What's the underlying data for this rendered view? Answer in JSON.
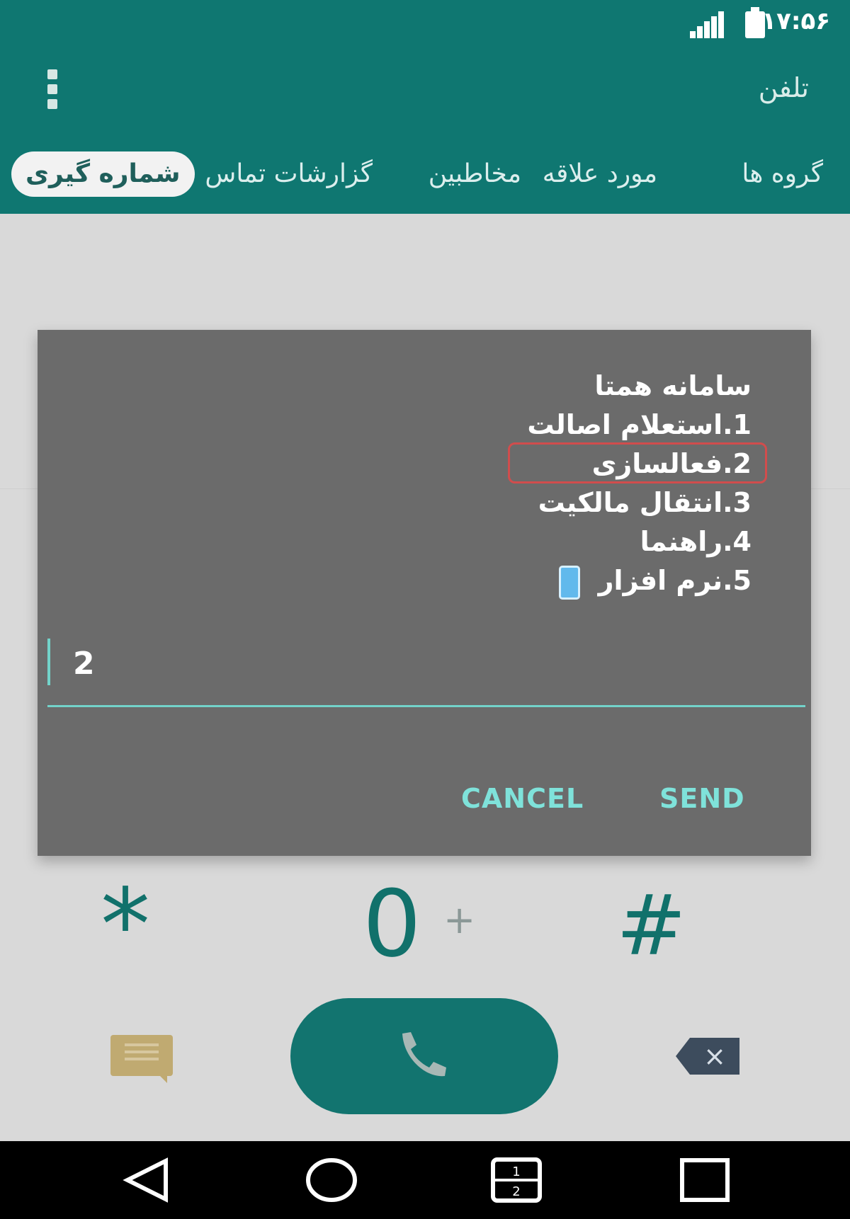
{
  "status_bar": {
    "time": "۱۷:۵۶"
  },
  "app_bar": {
    "title": "تلفن"
  },
  "tabs": [
    {
      "label": "گروه ها"
    },
    {
      "label": "مورد علاقه"
    },
    {
      "label": "مخاطبین"
    },
    {
      "label": "گزارشات تماس"
    },
    {
      "label": "شماره گیری"
    }
  ],
  "ussd_dialog": {
    "title": "سامانه همتا",
    "options": [
      "1.استعلام اصالت",
      "2.فعالسازی",
      "3.انتقال مالکیت",
      "4.راهنما",
      "5.نرم افزار"
    ],
    "input_value": "2",
    "cancel_label": "CANCEL",
    "send_label": "SEND"
  },
  "dialpad": {
    "star_label": "*",
    "zero_label": "0",
    "plus_label": "+",
    "hash_label": "#"
  },
  "icons": {
    "message": "message-icon",
    "call": "phone-icon",
    "backspace": "backspace-icon",
    "back": "back-icon",
    "home": "home-icon",
    "recent": "recent-apps-icon",
    "dual_sim": "dual-sim-icon"
  },
  "colors": {
    "primary": "#0f7771",
    "dialog": "#6b6b6b",
    "accent": "#7fe2da"
  }
}
